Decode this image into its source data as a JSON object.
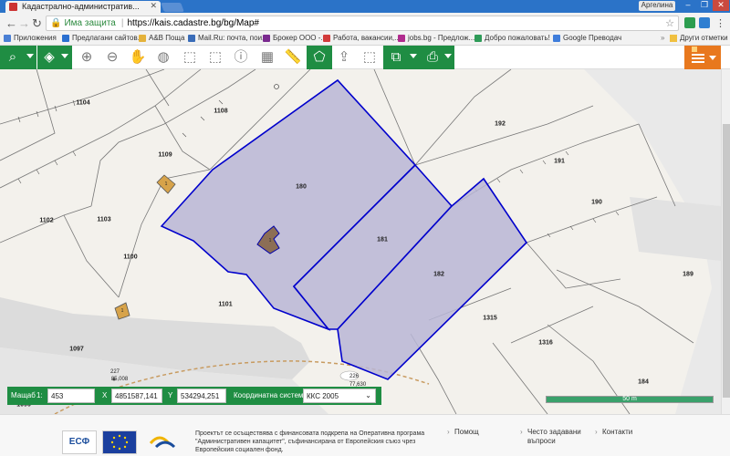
{
  "browser": {
    "tab_title": "Кадастрално-административ...",
    "user_label": "Аргелина",
    "secure_label": "Има защита",
    "url": "https://kais.cadastre.bg/bg/Map#",
    "bookmarks": [
      "Приложения",
      "Предлагани сайтов...",
      "A&B Поща",
      "Mail.Ru: почта, пои...",
      "Брокер ООО -...",
      "Работа, вакансии,...",
      "jobs.bg - Предлож...",
      "Добро пожаловать!",
      "Google Преводач"
    ],
    "other_bookmarks": "Други отметки"
  },
  "map": {
    "parcels": [
      {
        "id": "1104"
      },
      {
        "id": "1108"
      },
      {
        "id": "1109"
      },
      {
        "id": "1102"
      },
      {
        "id": "1103"
      },
      {
        "id": "1100"
      },
      {
        "id": "1101"
      },
      {
        "id": "1097"
      },
      {
        "id": "1096"
      },
      {
        "id": "180"
      },
      {
        "id": "181"
      },
      {
        "id": "182"
      },
      {
        "id": "192"
      },
      {
        "id": "191"
      },
      {
        "id": "190"
      },
      {
        "id": "189"
      },
      {
        "id": "1315"
      },
      {
        "id": "1316"
      },
      {
        "id": "184"
      }
    ],
    "spot_heights": [
      "227",
      "85,008",
      "226",
      "77,630"
    ],
    "building_marker": "1"
  },
  "coords": {
    "scale_label": "Мащаб",
    "scale_prefix": "1:",
    "scale_value": "453",
    "x_label": "X",
    "x_value": "4851587,141",
    "y_label": "Y",
    "y_value": "534294,251",
    "system_label": "Координатна система",
    "system_value": "ККС 2005"
  },
  "scalebar": {
    "label": "50 m"
  },
  "footer": {
    "logo_esf": "ЕСФ",
    "funding_text": "Проектът се осъществява с финансовата подкрепа на Оперативна програма \"Административен капацитет\", съфинансирана от Европейския съюз чрез Европейския социален фонд.",
    "links": [
      "Помощ",
      "Често задавани въпроси",
      "Контакти"
    ]
  },
  "colors": {
    "toolbar_green": "#1f8d43",
    "menu_orange": "#e8781e",
    "parcel_highlight": "#b9b6d6",
    "parcel_border": "#0000cc"
  }
}
